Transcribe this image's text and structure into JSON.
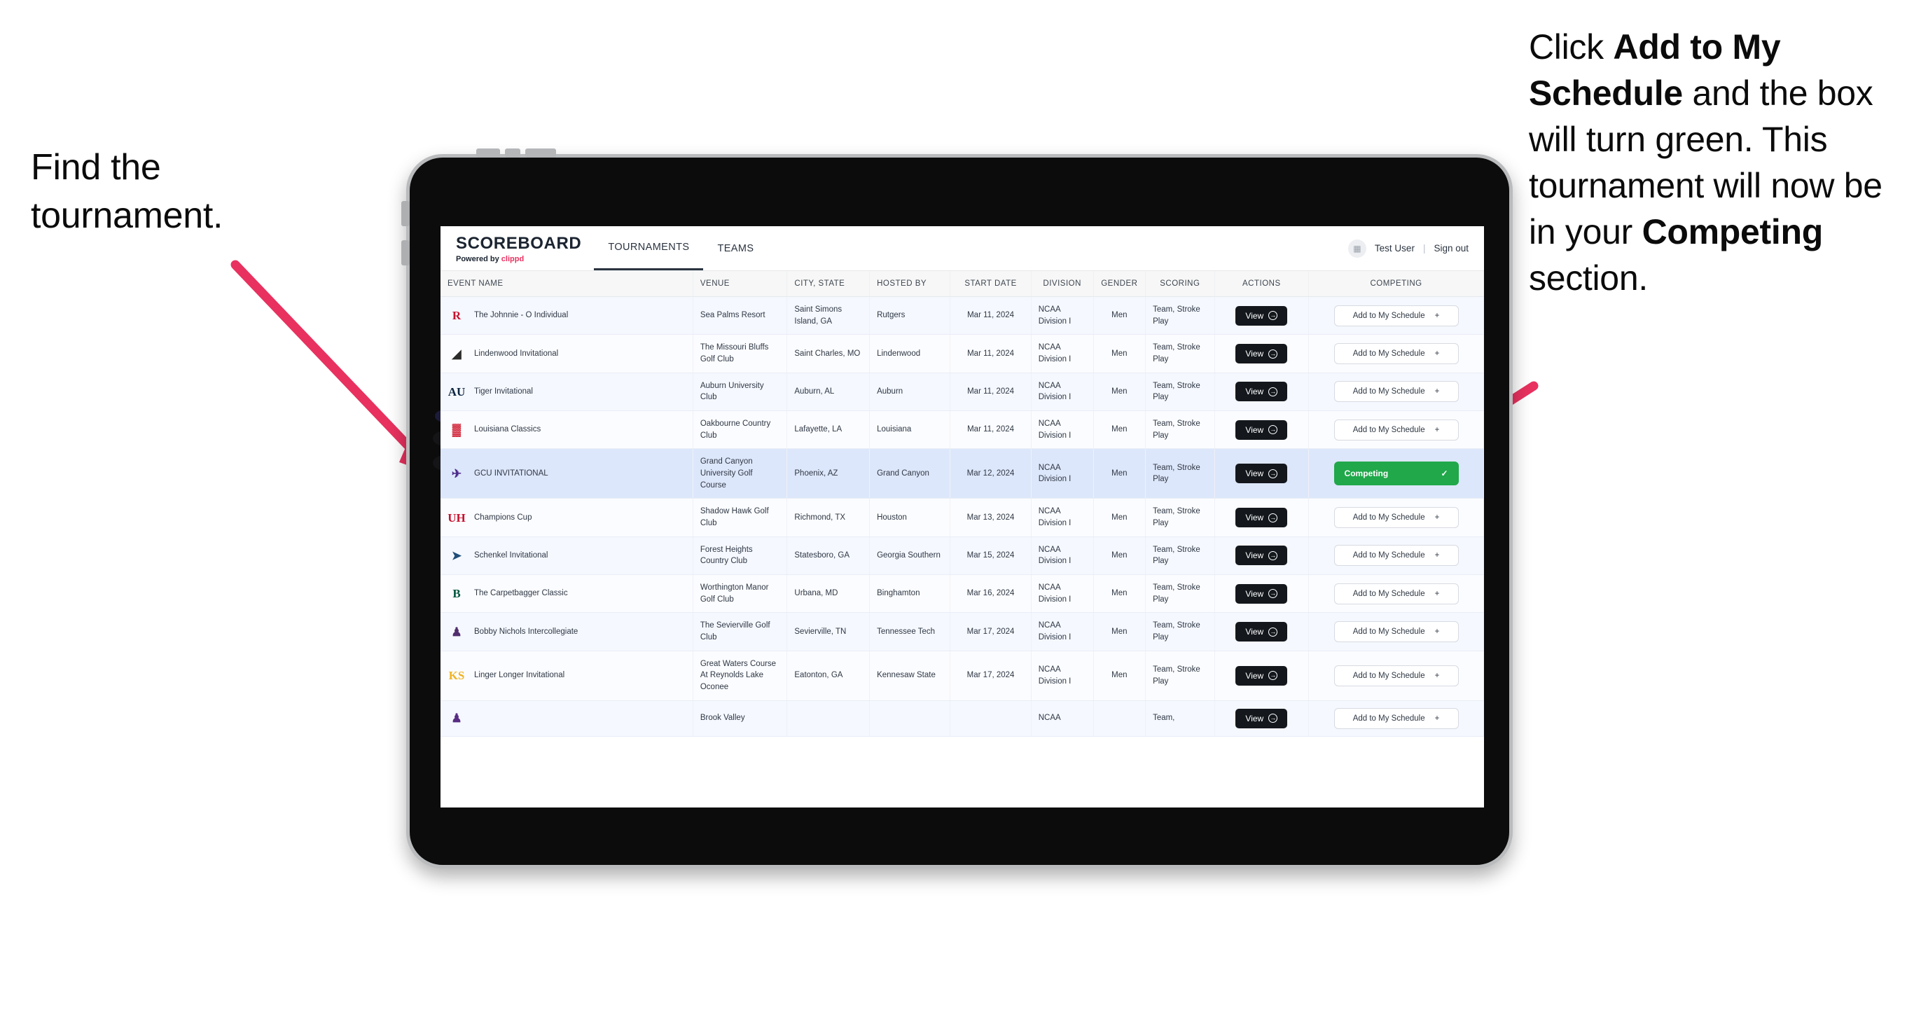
{
  "annotations": {
    "left": "Find the tournament.",
    "right_parts": [
      {
        "t": "Click ",
        "b": false
      },
      {
        "t": "Add to My Schedule",
        "b": true
      },
      {
        "t": " and the box will turn green. This tournament will now be in your ",
        "b": false
      },
      {
        "t": "Competing",
        "b": true
      },
      {
        "t": " section.",
        "b": false
      }
    ],
    "arrow_color": "#e8315f"
  },
  "app": {
    "brand": {
      "title": "SCOREBOARD",
      "powered_prefix": "Powered by ",
      "powered_brand": "clippd"
    },
    "tabs": [
      {
        "label": "TOURNAMENTS",
        "active": true
      },
      {
        "label": "TEAMS",
        "active": false
      }
    ],
    "account": {
      "avatar_icon": "user-avatar-icon",
      "user": "Test User",
      "separator": "|",
      "signout": "Sign out"
    },
    "table": {
      "columns": [
        "EVENT NAME",
        "VENUE",
        "CITY, STATE",
        "HOSTED BY",
        "START DATE",
        "DIVISION",
        "GENDER",
        "SCORING",
        "ACTIONS",
        "COMPETING"
      ],
      "view_label": "View",
      "add_label": "Add to My Schedule",
      "add_icon": "plus-icon",
      "competing_label": "Competing",
      "competing_icon": "check-icon",
      "rows": [
        {
          "logo": "R",
          "logo_color": "#c4122e",
          "event": "The Johnnie - O Individual",
          "venue": "Sea Palms Resort",
          "city": "Saint Simons Island, GA",
          "hosted": "Rutgers",
          "date": "Mar 11, 2024",
          "division": "NCAA Division I",
          "gender": "Men",
          "scoring": "Team, Stroke Play",
          "competing": false
        },
        {
          "logo": "◢",
          "logo_color": "#2b2b2b",
          "event": "Lindenwood Invitational",
          "venue": "The Missouri Bluffs Golf Club",
          "city": "Saint Charles, MO",
          "hosted": "Lindenwood",
          "date": "Mar 11, 2024",
          "division": "NCAA Division I",
          "gender": "Men",
          "scoring": "Team, Stroke Play",
          "competing": false
        },
        {
          "logo": "AU",
          "logo_color": "#0c2340",
          "event": "Tiger Invitational",
          "venue": "Auburn University Club",
          "city": "Auburn, AL",
          "hosted": "Auburn",
          "date": "Mar 11, 2024",
          "division": "NCAA Division I",
          "gender": "Men",
          "scoring": "Team, Stroke Play",
          "competing": false
        },
        {
          "logo": "▓",
          "logo_color": "#ce1126",
          "event": "Louisiana Classics",
          "venue": "Oakbourne Country Club",
          "city": "Lafayette, LA",
          "hosted": "Louisiana",
          "date": "Mar 11, 2024",
          "division": "NCAA Division I",
          "gender": "Men",
          "scoring": "Team, Stroke Play",
          "competing": false
        },
        {
          "logo": "✈",
          "logo_color": "#4f2d8c",
          "event": "GCU INVITATIONAL",
          "venue": "Grand Canyon University Golf Course",
          "city": "Phoenix, AZ",
          "hosted": "Grand Canyon",
          "date": "Mar 12, 2024",
          "division": "NCAA Division I",
          "gender": "Men",
          "scoring": "Team, Stroke Play",
          "competing": true
        },
        {
          "logo": "UH",
          "logo_color": "#c8102e",
          "event": "Champions Cup",
          "venue": "Shadow Hawk Golf Club",
          "city": "Richmond, TX",
          "hosted": "Houston",
          "date": "Mar 13, 2024",
          "division": "NCAA Division I",
          "gender": "Men",
          "scoring": "Team, Stroke Play",
          "competing": false
        },
        {
          "logo": "➤",
          "logo_color": "#1f4e79",
          "event": "Schenkel Invitational",
          "venue": "Forest Heights Country Club",
          "city": "Statesboro, GA",
          "hosted": "Georgia Southern",
          "date": "Mar 15, 2024",
          "division": "NCAA Division I",
          "gender": "Men",
          "scoring": "Team, Stroke Play",
          "competing": false
        },
        {
          "logo": "B",
          "logo_color": "#00553e",
          "event": "The Carpetbagger Classic",
          "venue": "Worthington Manor Golf Club",
          "city": "Urbana, MD",
          "hosted": "Binghamton",
          "date": "Mar 16, 2024",
          "division": "NCAA Division I",
          "gender": "Men",
          "scoring": "Team, Stroke Play",
          "competing": false
        },
        {
          "logo": "♟",
          "logo_color": "#512d6d",
          "event": "Bobby Nichols Intercollegiate",
          "venue": "The Sevierville Golf Club",
          "city": "Sevierville, TN",
          "hosted": "Tennessee Tech",
          "date": "Mar 17, 2024",
          "division": "NCAA Division I",
          "gender": "Men",
          "scoring": "Team, Stroke Play",
          "competing": false
        },
        {
          "logo": "KS",
          "logo_color": "#f0b323",
          "event": "Linger Longer Invitational",
          "venue": "Great Waters Course At Reynolds Lake Oconee",
          "city": "Eatonton, GA",
          "hosted": "Kennesaw State",
          "date": "Mar 17, 2024",
          "division": "NCAA Division I",
          "gender": "Men",
          "scoring": "Team, Stroke Play",
          "competing": false
        },
        {
          "logo": "♟",
          "logo_color": "#582c83",
          "event": "",
          "venue": "Brook Valley",
          "city": "",
          "hosted": "",
          "date": "",
          "division": "NCAA",
          "gender": "",
          "scoring": "Team,",
          "competing": false
        }
      ]
    }
  }
}
